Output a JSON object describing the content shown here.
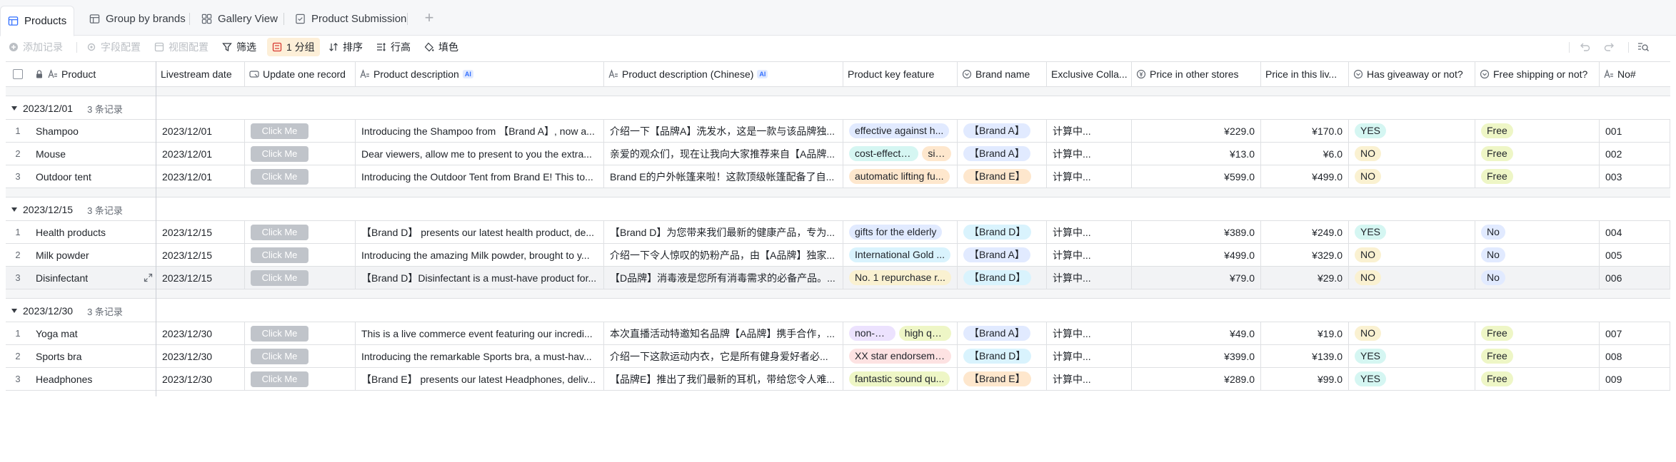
{
  "tabs": [
    {
      "label": "Products",
      "icon": "table-icon",
      "active": true
    },
    {
      "label": "Group by brands",
      "icon": "table-icon"
    },
    {
      "label": "Gallery View",
      "icon": "gallery-icon"
    },
    {
      "label": "Product Submission",
      "icon": "form-icon"
    }
  ],
  "toolbar": {
    "add_record": "添加记录",
    "field_config": "字段配置",
    "view_config": "视图配置",
    "filter": "筛选",
    "group": "1 分组",
    "sort": "排序",
    "row_height": "行高",
    "fill": "填色"
  },
  "columns": {
    "product": "Product",
    "livestream_date": "Livestream date",
    "update_one": "Update one record",
    "desc": "Product description",
    "desc_cn": "Product description (Chinese)",
    "key_feature": "Product key feature",
    "brand": "Brand name",
    "exclusive": "Exclusive Colla...",
    "price_other": "Price in other stores",
    "price_live": "Price in this liv...",
    "giveaway": "Has giveaway or not?",
    "shipping": "Free shipping or not?",
    "no": "No#",
    "ai": "AI"
  },
  "colors": {
    "accent": "#3370ff",
    "tag_blue": "#e1eaff",
    "tag_orange": "#fee7cd",
    "tag_lime": "#eef6c6",
    "tag_teal": "#d5f6f2",
    "tag_cyan": "#d9f3fd",
    "tag_pink": "#fde2e2",
    "tag_purple": "#ece2fe",
    "tag_yellow": "#faf1d1"
  },
  "groups": [
    {
      "title": "2023/12/01",
      "count": "3 条记录",
      "rows": [
        {
          "idx": "1",
          "product": "Shampoo",
          "date": "2023/12/01",
          "btn": "Click Me",
          "desc": "Introducing the Shampoo from 【Brand A】, now a...",
          "desc_cn": "介绍一下【品牌A】洗发水，这是一款与该品牌独...",
          "features": [
            {
              "t": "effective against h...",
              "c": "#e1eaff"
            }
          ],
          "brand": "【Brand A】",
          "brand_c": "#e1eaff",
          "exclusive": "计算中...",
          "price_other": "¥229.0",
          "price_live": "¥170.0",
          "giveaway": "YES",
          "giveaway_c": "#d5f6f2",
          "ship": "Free",
          "ship_c": "#eef6c6",
          "no": "001"
        },
        {
          "idx": "2",
          "product": "Mouse",
          "date": "2023/12/01",
          "btn": "Click Me",
          "desc": "Dear viewers, allow me to present to you the extra...",
          "desc_cn": "亲爱的观众们，现在让我向大家推荐来自【A品牌...",
          "features": [
            {
              "t": "cost-effective",
              "c": "#d5f6f2"
            },
            {
              "t": "sil...",
              "c": "#fee7cd"
            }
          ],
          "brand": "【Brand A】",
          "brand_c": "#e1eaff",
          "exclusive": "计算中...",
          "price_other": "¥13.0",
          "price_live": "¥6.0",
          "giveaway": "NO",
          "giveaway_c": "#faf1d1",
          "ship": "Free",
          "ship_c": "#eef6c6",
          "no": "002"
        },
        {
          "idx": "3",
          "product": "Outdoor tent",
          "date": "2023/12/01",
          "btn": "Click Me",
          "desc": "Introducing the Outdoor Tent from Brand E! This to...",
          "desc_cn": "Brand E的户外帐篷来啦！这款顶级帐篷配备了自...",
          "features": [
            {
              "t": "automatic lifting fu...",
              "c": "#fee7cd"
            }
          ],
          "brand": "【Brand E】",
          "brand_c": "#fee7cd",
          "exclusive": "计算中...",
          "price_other": "¥599.0",
          "price_live": "¥499.0",
          "giveaway": "NO",
          "giveaway_c": "#faf1d1",
          "ship": "Free",
          "ship_c": "#eef6c6",
          "no": "003"
        }
      ]
    },
    {
      "title": "2023/12/15",
      "count": "3 条记录",
      "rows": [
        {
          "idx": "1",
          "product": "Health products",
          "date": "2023/12/15",
          "btn": "Click Me",
          "desc": "【Brand D】 presents our latest health product, de...",
          "desc_cn": "【Brand D】为您带来我们最新的健康产品，专为...",
          "features": [
            {
              "t": "gifts for the elderly",
              "c": "#e1eaff"
            }
          ],
          "brand": "【Brand D】",
          "brand_c": "#d9f3fd",
          "exclusive": "计算中...",
          "price_other": "¥389.0",
          "price_live": "¥249.0",
          "giveaway": "YES",
          "giveaway_c": "#d5f6f2",
          "ship": "No",
          "ship_c": "#e1eaff",
          "no": "004"
        },
        {
          "idx": "2",
          "product": "Milk powder",
          "date": "2023/12/15",
          "btn": "Click Me",
          "desc": "Introducing the amazing Milk powder, brought to y...",
          "desc_cn": "介绍一下令人惊叹的奶粉产品，由【A品牌】独家...",
          "features": [
            {
              "t": "International Gold ...",
              "c": "#d9f3fd"
            }
          ],
          "brand": "【Brand A】",
          "brand_c": "#e1eaff",
          "exclusive": "计算中...",
          "price_other": "¥499.0",
          "price_live": "¥329.0",
          "giveaway": "NO",
          "giveaway_c": "#faf1d1",
          "ship": "No",
          "ship_c": "#e1eaff",
          "no": "005"
        },
        {
          "idx": "3",
          "product": "Disinfectant",
          "date": "2023/12/15",
          "btn": "Click Me",
          "desc": "【Brand D】Disinfectant is a must-have product for...",
          "desc_cn": "【D品牌】消毒液是您所有消毒需求的必备产品。...",
          "features": [
            {
              "t": "No. 1 repurchase r...",
              "c": "#faf1d1"
            }
          ],
          "brand": "【Brand D】",
          "brand_c": "#d9f3fd",
          "exclusive": "计算中...",
          "price_other": "¥79.0",
          "price_live": "¥29.0",
          "giveaway": "NO",
          "giveaway_c": "#faf1d1",
          "ship": "No",
          "ship_c": "#e1eaff",
          "no": "006",
          "hover": true
        }
      ]
    },
    {
      "title": "2023/12/30",
      "count": "3 条记录",
      "rows": [
        {
          "idx": "1",
          "product": "Yoga mat",
          "date": "2023/12/30",
          "btn": "Click Me",
          "desc": "This is a live commerce event featuring our incredi...",
          "desc_cn": "本次直播活动特邀知名品牌【A品牌】携手合作，...",
          "features": [
            {
              "t": "non-slip",
              "c": "#ece2fe"
            },
            {
              "t": "high qu...",
              "c": "#eef6c6"
            }
          ],
          "brand": "【Brand A】",
          "brand_c": "#e1eaff",
          "exclusive": "计算中...",
          "price_other": "¥49.0",
          "price_live": "¥19.0",
          "giveaway": "NO",
          "giveaway_c": "#faf1d1",
          "ship": "Free",
          "ship_c": "#eef6c6",
          "no": "007"
        },
        {
          "idx": "2",
          "product": "Sports bra",
          "date": "2023/12/30",
          "btn": "Click Me",
          "desc": "Introducing the remarkable Sports bra, a must-hav...",
          "desc_cn": "介绍一下这款运动内衣，它是所有健身爱好者必...",
          "features": [
            {
              "t": "XX star endorsement",
              "c": "#fde2e2"
            }
          ],
          "brand": "【Brand D】",
          "brand_c": "#d9f3fd",
          "exclusive": "计算中...",
          "price_other": "¥399.0",
          "price_live": "¥139.0",
          "giveaway": "YES",
          "giveaway_c": "#d5f6f2",
          "ship": "Free",
          "ship_c": "#eef6c6",
          "no": "008"
        },
        {
          "idx": "3",
          "product": "Headphones",
          "date": "2023/12/30",
          "btn": "Click Me",
          "desc": "【Brand E】 presents our latest Headphones, deliv...",
          "desc_cn": "【品牌E】推出了我们最新的耳机，带给您令人难...",
          "features": [
            {
              "t": "fantastic sound qu...",
              "c": "#eef6c6"
            }
          ],
          "brand": "【Brand E】",
          "brand_c": "#fee7cd",
          "exclusive": "计算中...",
          "price_other": "¥289.0",
          "price_live": "¥99.0",
          "giveaway": "YES",
          "giveaway_c": "#d5f6f2",
          "ship": "Free",
          "ship_c": "#eef6c6",
          "no": "009"
        }
      ]
    }
  ]
}
